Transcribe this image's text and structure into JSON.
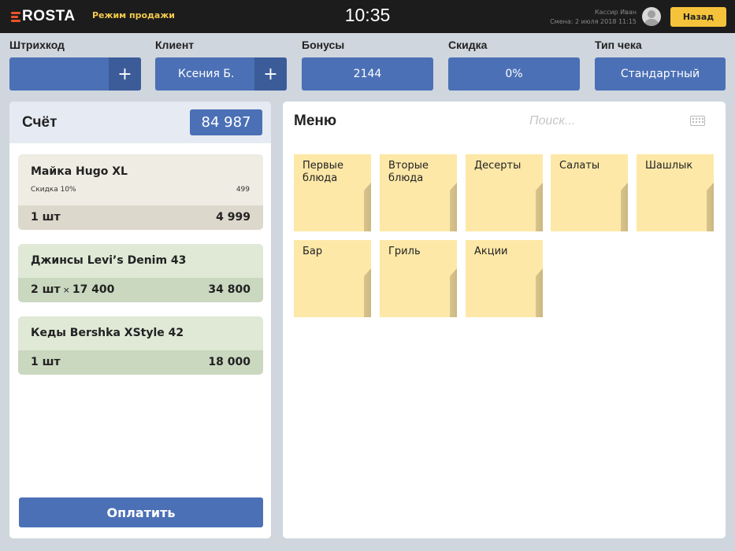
{
  "topbar": {
    "logo": "ROSTA",
    "mode": "Режим продажи",
    "time": "10:35",
    "cashier": "Кассир Иван",
    "shift": "Смена: 2 июля 2018 11:15",
    "back_label": "Назад"
  },
  "fields": {
    "barcode": {
      "label": "Штрихкод",
      "value": ""
    },
    "client": {
      "label": "Клиент",
      "value": "Ксения Б."
    },
    "bonuses": {
      "label": "Бонусы",
      "value": "2144"
    },
    "discount": {
      "label": "Скидка",
      "value": "0%"
    },
    "receipt_type": {
      "label": "Тип чека",
      "value": "Стандартный"
    }
  },
  "bill": {
    "title": "Счёт",
    "total": "84 987",
    "items": [
      {
        "name": "Майка Hugo XL",
        "discount_label": "Скидка 10%",
        "discount_amount": "499",
        "qty": "1 шт",
        "sum": "4 999"
      },
      {
        "name": "Джинсы Levi’s Denim 43",
        "qty": "2 шт",
        "times": "×",
        "unit_price": "17 400",
        "sum": "34 800"
      },
      {
        "name": "Кеды Bershka XStyle 42",
        "qty": "1 шт",
        "sum": "18 000"
      }
    ],
    "pay_label": "Оплатить"
  },
  "menu": {
    "title": "Меню",
    "search_placeholder": "Поиск...",
    "categories": [
      "Первые\nблюда",
      "Вторые\nблюда",
      "Десерты",
      "Салаты",
      "Шашлык",
      "Бар",
      "Гриль",
      "Акции"
    ]
  },
  "colors": {
    "topbar": "#1c1c1c",
    "accent_blue": "#4b70b6",
    "accent_yellow": "#f5c33b",
    "tile": "#fde8a8",
    "card_beige": "#efece3",
    "card_green": "#dfe9d6"
  }
}
